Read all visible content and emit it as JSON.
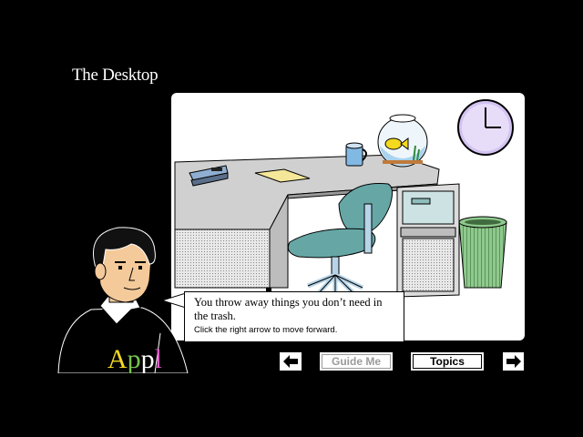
{
  "title": "The Desktop",
  "bubble": {
    "main_text": "You throw away things you don’t need in the trash.",
    "hint_text": "Click the right arrow to move forward."
  },
  "nav": {
    "back_icon": "left-arrow-icon",
    "guide_label": "Guide Me",
    "topics_label": "Topics",
    "forward_icon": "right-arrow-icon"
  },
  "sweater_text": "Appl",
  "colors": {
    "desk": "#d0d0d0",
    "chair": "#66a7a6",
    "clock": "#d3c3f1",
    "trash": "#8fc98d",
    "mug": "#82b9e3",
    "fish": "#f5d91f"
  }
}
